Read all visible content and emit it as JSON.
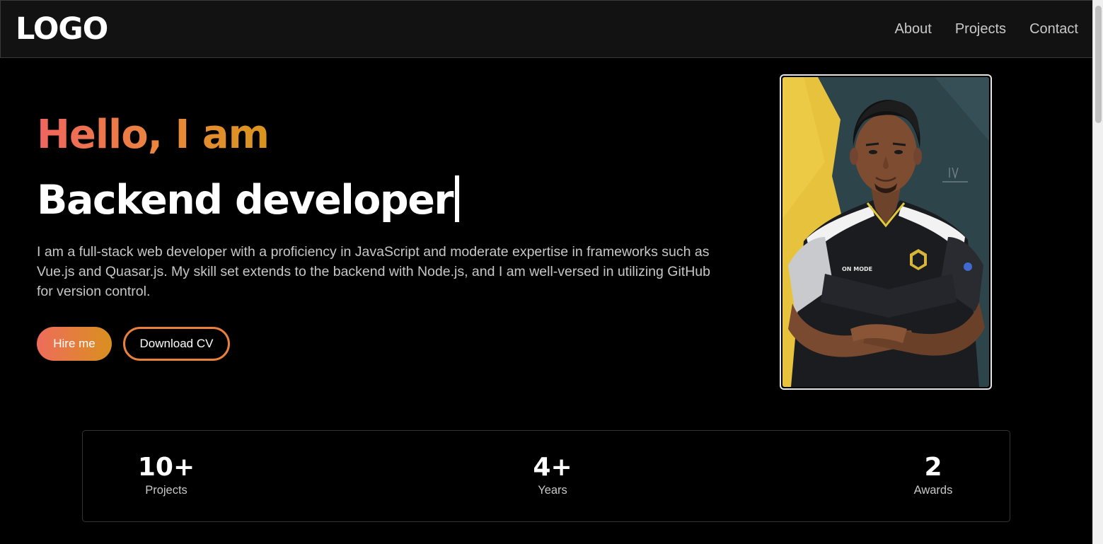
{
  "header": {
    "logo": "LOGO",
    "nav": [
      "About",
      "Projects",
      "Contact"
    ]
  },
  "hero": {
    "greeting": "Hello, I am",
    "role": "Backend developer",
    "bio": "I am a full-stack web developer with a proficiency in JavaScript and moderate expertise in frameworks such as Vue.js and Quasar.js. My skill set extends to the backend with Node.js, and I am well-versed in utilizing GitHub for version control.",
    "hire_label": "Hire me",
    "cv_label": "Download CV",
    "jersey_text": "ON MODE"
  },
  "stats": [
    {
      "value": "10+",
      "label": "Projects"
    },
    {
      "value": "4+",
      "label": "Years"
    },
    {
      "value": "2",
      "label": "Awards"
    }
  ],
  "colors": {
    "accent_start": "#f0645f",
    "accent_end": "#d9951c",
    "background": "#000000",
    "navbar": "#121212"
  }
}
